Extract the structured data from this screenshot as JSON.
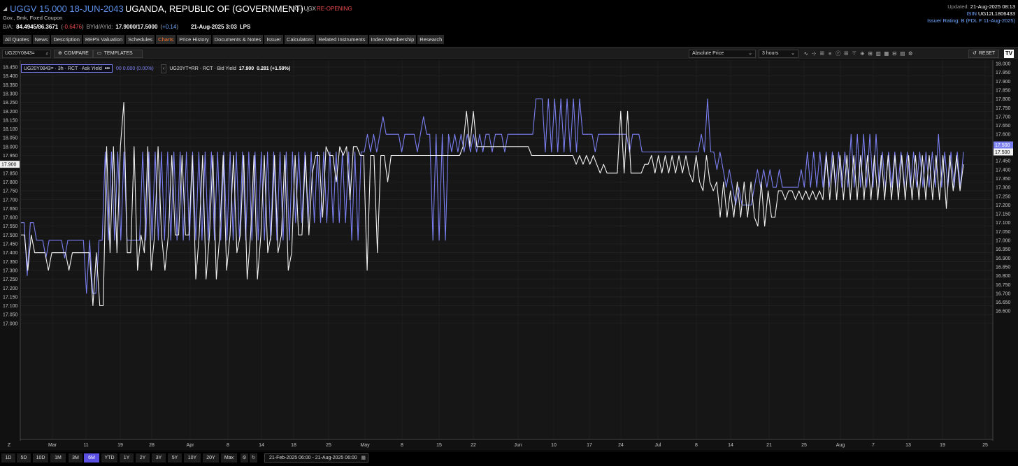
{
  "header": {
    "ticker": "UGGV 15.000 18-JUN-2043",
    "issuer": "UGANDA, REPUBLIC OF (GOVERNMENT)",
    "ccy": "UG / UGX",
    "status": "RE-OPENING",
    "subtitle": "Gov., Bmk, Fixed Coupon",
    "ba_label": "B/A:",
    "ba_value": "84.4945/86.3671",
    "ba_change_open": "(",
    "ba_change": "-0.6476",
    "ba_change_close": ")",
    "yld_label": "BYld/AYld:",
    "yld_value": "17.9000/17.5000",
    "yld_change_open": "(",
    "yld_change": "+0.14",
    "yld_change_close": ")",
    "datetime": "21-Aug-2025 3:03",
    "source": "LPS",
    "updated_label": "Updated:",
    "updated_value": "21-Aug-2025 08:13",
    "isin_label": "ISIN",
    "isin_value": "UG12L1806433",
    "rating_label": "Issuer Rating:",
    "rating_value": "B (FDL F 11-Aug-2025)"
  },
  "tabs": [
    "All Quotes",
    "News",
    "Description",
    "REPS Valuation",
    "Schedules",
    "Charts",
    "Price History",
    "Documents & Notes",
    "Issuer",
    "Calculators",
    "Related Instruments",
    "Index Membership",
    "Research"
  ],
  "active_tab": "Charts",
  "toolbar": {
    "ric": "UG20Y0843=",
    "compare": "COMPARE",
    "templates": "TEMPLATES",
    "price_mode": "Absolute Price",
    "interval": "3 hours",
    "reset": "RESET",
    "logo": "TV"
  },
  "tool_icons": [
    "line-tool-icon",
    "crosshair-icon",
    "table-icon",
    "indicator-icon",
    "draw-icon",
    "align-icon",
    "measure-icon",
    "zoom-icon",
    "layout-icon",
    "bars-icon",
    "candles-icon",
    "lines-icon",
    "area-icon",
    "settings-icon"
  ],
  "legend": {
    "s1_name": "UG20Y0843= · 3h · RCT · Ask Yield",
    "s1_more": "•••",
    "s1_vals": "00  0.000 (0.00%)",
    "s2_arrow": "‹",
    "s2_name": "UG20YT=RR · RCT · Bid Yield",
    "s2_last": "17.900",
    "s2_change": "0.281 (+1.59%)"
  },
  "colors": {
    "ask_series": "#7a7ff0",
    "bid_series": "#f2f2f2",
    "background": "#161616",
    "grid": "#262626",
    "accent": "#5a4fe0"
  },
  "bottom": {
    "ranges": [
      "1D",
      "5D",
      "10D",
      "1M",
      "3M",
      "6M",
      "YTD",
      "1Y",
      "2Y",
      "3Y",
      "5Y",
      "10Y",
      "20Y",
      "Max"
    ],
    "active_range": "6M",
    "date_range": "21-Feb-2025 06:00 - 21-Aug-2025 06:00"
  },
  "chart_data": {
    "type": "line",
    "x_ticks": [
      "Mar",
      "11",
      "19",
      "28",
      "Apr",
      "8",
      "14",
      "18",
      "25",
      "May",
      "8",
      "15",
      "22",
      "Jun",
      "10",
      "17",
      "24",
      "Jul",
      "8",
      "14",
      "21",
      "25",
      "Aug",
      "7",
      "13",
      "19",
      "25"
    ],
    "x_start_label": "Z",
    "y_left": {
      "ticks": [
        "18.450",
        "18.400",
        "18.350",
        "18.300",
        "18.250",
        "18.200",
        "18.150",
        "18.100",
        "18.050",
        "18.000",
        "17.950",
        "17.900",
        "17.850",
        "17.800",
        "17.750",
        "17.700",
        "17.650",
        "17.600",
        "17.550",
        "17.500",
        "17.450",
        "17.400",
        "17.350",
        "17.300",
        "17.250",
        "17.200",
        "17.150",
        "17.100",
        "17.050",
        "17.000"
      ],
      "marker": "17.900"
    },
    "y_right": {
      "ticks": [
        "18.000",
        "17.950",
        "17.900",
        "17.850",
        "17.800",
        "17.750",
        "17.700",
        "17.650",
        "17.600",
        "17.550",
        "17.500",
        "17.450",
        "17.400",
        "17.350",
        "17.300",
        "17.250",
        "17.200",
        "17.150",
        "17.100",
        "17.050",
        "17.000",
        "16.950",
        "16.900",
        "16.850",
        "16.800",
        "16.750",
        "16.700",
        "16.650",
        "16.600"
      ],
      "marker_ask": "17.500",
      "marker_bid": "17.500"
    },
    "series": [
      {
        "name": "UG20Y0843= · 3h · RCT · Ask Yield",
        "axis": "right",
        "color": "#7a7ff0",
        "values": [
          17.1,
          17.1,
          16.8,
          17.1,
          17.1,
          17.0,
          17.0,
          17.0,
          16.9,
          17.0,
          17.0,
          17.0,
          17.0,
          17.0,
          16.9,
          17.0,
          17.0,
          17.0,
          17.0,
          17.0,
          17.0,
          16.7,
          17.0,
          16.7,
          16.7,
          17.0,
          17.0,
          17.5,
          17.0,
          17.5,
          17.0,
          17.5,
          17.0,
          17.5,
          17.0,
          17.0,
          17.0,
          17.0,
          17.0,
          17.5,
          17.0,
          17.5,
          17.0,
          17.5,
          17.0,
          17.5,
          17.0,
          17.5,
          17.0,
          17.5,
          17.0,
          17.5,
          17.0,
          17.5,
          17.0,
          17.5,
          17.0,
          17.5,
          17.0,
          17.5,
          17.0,
          17.5,
          17.0,
          17.5,
          17.0,
          17.5,
          17.0,
          17.5,
          17.0,
          17.5,
          17.0,
          17.5,
          17.0,
          17.5,
          17.0,
          17.5,
          17.0,
          17.5,
          17.0,
          17.5,
          17.0,
          17.5,
          17.0,
          17.5,
          17.0,
          17.5,
          17.0,
          17.5,
          17.1,
          17.5,
          17.1,
          17.5,
          17.1,
          17.5,
          17.1,
          17.5,
          17.1,
          17.5,
          17.1,
          17.5,
          17.1,
          17.5,
          17.1,
          17.5,
          17.1,
          17.5,
          17.0,
          17.5,
          17.0,
          17.5,
          17.5,
          17.6,
          17.5,
          17.6,
          17.5,
          17.6,
          17.7,
          17.6,
          17.6,
          17.6,
          17.6,
          17.6,
          17.5,
          17.6,
          17.6,
          17.6,
          17.6,
          17.5,
          17.6,
          17.7,
          17.6,
          17.6,
          17.0,
          17.6,
          17.0,
          17.6,
          17.0,
          17.6,
          17.5,
          17.6,
          17.5,
          17.6,
          17.5,
          17.6,
          17.5,
          17.6,
          17.5,
          17.6,
          17.5,
          17.6,
          17.6,
          17.5,
          17.6,
          17.6,
          17.6,
          17.5,
          17.6,
          17.6,
          17.6,
          17.6,
          17.6,
          17.6,
          17.6,
          17.6,
          17.6,
          17.8,
          17.8,
          17.8,
          17.5,
          17.8,
          17.5,
          17.8,
          17.5,
          17.8,
          17.5,
          17.8,
          17.5,
          17.8,
          17.5,
          17.8,
          17.6,
          17.6,
          17.6,
          17.6,
          17.5,
          17.6,
          17.6,
          17.6,
          17.6,
          17.6,
          17.6,
          17.6,
          17.6,
          17.6,
          17.6,
          17.5,
          17.6,
          17.6,
          17.6,
          17.5,
          17.5,
          17.5,
          17.5,
          17.5,
          17.5,
          17.5,
          17.5,
          17.5,
          17.5,
          17.5,
          17.5,
          17.5,
          17.5,
          17.5,
          17.5,
          17.5,
          17.5,
          17.5,
          17.6,
          17.5,
          17.8,
          17.5,
          17.5,
          17.4,
          17.5,
          17.4,
          17.3,
          17.4,
          17.3,
          17.2,
          17.3,
          17.2,
          17.2,
          17.2,
          17.2,
          17.3,
          17.4,
          17.3,
          17.4,
          17.3,
          17.4,
          17.3,
          17.3,
          17.4,
          17.3,
          17.3,
          17.3,
          17.3,
          17.3,
          17.3,
          17.4,
          17.3,
          17.5,
          17.3,
          17.5,
          17.3,
          17.5,
          17.3,
          17.5,
          17.3,
          17.5,
          17.3,
          17.5,
          17.3,
          17.5,
          17.3,
          17.6,
          17.3,
          17.6,
          17.3,
          17.6,
          17.3,
          17.6,
          17.3,
          17.6,
          17.3,
          17.5,
          17.3,
          17.5,
          17.3,
          17.5,
          17.3,
          17.5,
          17.3,
          17.5,
          17.3,
          17.5,
          17.3,
          17.5,
          17.3,
          17.5,
          17.3,
          17.5,
          17.3,
          17.6,
          17.3,
          17.5,
          17.3,
          17.5,
          17.3,
          17.5,
          17.3,
          17.5
        ]
      },
      {
        "name": "UG20YT=RR · RCT · Bid Yield",
        "axis": "left",
        "color": "#f2f2f2",
        "values": [
          17.5,
          17.5,
          17.3,
          17.5,
          17.4,
          17.4,
          17.4,
          17.4,
          17.3,
          17.4,
          17.4,
          17.4,
          17.4,
          17.4,
          17.3,
          17.4,
          17.4,
          17.4,
          17.4,
          17.4,
          17.4,
          17.1,
          17.4,
          17.1,
          17.1,
          18.0,
          17.4,
          18.0,
          17.4,
          18.0,
          18.25,
          17.4,
          17.4,
          18.0,
          17.3,
          17.5,
          17.4,
          18.0,
          17.3,
          17.5,
          18.0,
          17.5,
          17.3,
          17.5,
          17.95,
          17.5,
          17.5,
          17.95,
          17.5,
          17.5,
          17.95,
          17.25,
          17.5,
          17.95,
          17.25,
          17.5,
          17.95,
          17.25,
          17.5,
          17.95,
          17.3,
          17.5,
          17.95,
          17.4,
          17.5,
          17.95,
          17.25,
          17.5,
          17.95,
          17.25,
          17.5,
          17.95,
          17.4,
          17.5,
          17.95,
          17.4,
          17.5,
          17.95,
          17.3,
          17.4,
          17.95,
          17.5,
          17.5,
          17.95,
          17.5,
          17.85,
          17.95,
          17.95,
          17.6,
          18.0,
          17.95,
          17.95,
          17.8,
          18.0,
          17.95,
          18.0,
          17.7,
          18.0,
          18.0,
          17.95,
          17.95,
          17.3,
          17.95,
          17.95,
          17.4,
          17.95,
          17.95,
          17.8,
          17.95,
          17.95,
          17.95,
          17.95,
          17.95,
          17.95,
          17.95,
          17.95,
          17.95,
          17.95,
          17.95,
          17.95,
          17.95,
          17.95,
          17.95,
          17.95,
          17.95,
          17.95,
          17.95,
          17.95,
          17.95,
          18.0,
          18.2,
          18.0,
          18.2,
          18.0,
          18.0,
          18.0,
          18.0,
          18.0,
          18.0,
          18.0,
          18.0,
          18.0,
          18.0,
          18.0,
          18.0,
          18.0,
          18.0,
          18.0,
          18.0,
          17.95,
          17.95,
          17.95,
          17.95,
          17.95,
          17.95,
          17.95,
          17.95,
          17.95,
          17.95,
          17.95,
          17.95,
          17.95,
          17.9,
          17.95,
          17.9,
          17.95,
          17.9,
          17.95,
          17.9,
          17.85,
          17.9,
          17.85,
          17.85,
          17.85,
          17.85,
          18.2,
          17.85,
          18.2,
          17.85,
          17.85,
          17.85,
          17.85,
          17.9,
          17.9,
          17.95,
          17.85,
          17.95,
          17.85,
          17.95,
          17.85,
          17.95,
          17.85,
          17.95,
          17.85,
          17.95,
          17.85,
          17.8,
          17.95,
          17.8,
          17.75,
          17.95,
          17.8,
          17.75,
          17.8,
          17.6,
          17.8,
          17.6,
          17.75,
          17.6,
          17.8,
          17.6,
          17.8,
          17.6,
          17.8,
          17.6,
          17.55,
          17.8,
          17.55,
          17.75,
          17.6,
          17.6,
          17.75,
          17.75,
          17.7,
          17.75,
          17.75,
          17.7,
          17.75,
          17.7,
          17.75,
          17.7,
          17.75,
          17.7,
          17.75,
          17.7,
          17.95,
          17.7,
          17.95,
          17.7,
          17.95,
          17.7,
          17.95,
          17.7,
          17.95,
          17.7,
          17.95,
          17.7,
          17.95,
          17.7,
          17.95,
          17.7,
          17.95,
          17.7,
          17.95,
          17.7,
          17.95,
          17.7,
          17.95,
          17.7,
          17.95,
          17.7,
          17.95,
          17.7,
          17.95,
          17.7,
          17.95,
          17.7,
          17.95,
          17.7,
          17.95,
          17.65,
          17.95,
          17.75,
          17.95,
          17.75,
          17.9
        ]
      }
    ]
  }
}
